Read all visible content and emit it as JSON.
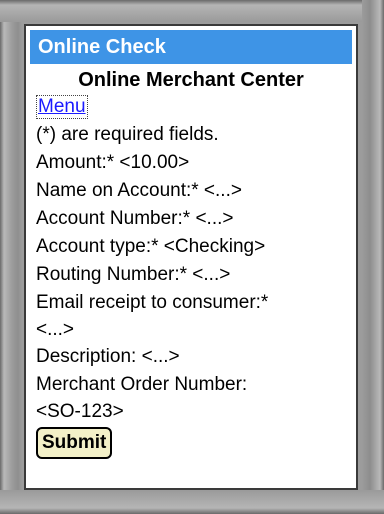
{
  "title_bar": "Online Check",
  "heading": "Online Merchant Center",
  "menu_link": "Menu",
  "required_note": "(*) are required fields.",
  "fields": {
    "amount": "Amount:* <10.00>",
    "name_on_account": "Name on Account:* <...>",
    "account_number": "Account Number:* <...>",
    "account_type": "Account type:* <Checking>",
    "routing_number": "Routing Number:* <...>",
    "email_receipt_label": "Email receipt to consumer:*",
    "email_receipt_value": "<...>",
    "description": "Description: <...>",
    "merchant_order_label": "Merchant Order Number:",
    "merchant_order_value": "<SO-123>"
  },
  "submit_label": "Submit",
  "colors": {
    "title_bar_bg": "#3e94e6",
    "link": "#1a1aff",
    "button_bg": "#f3f0c8"
  }
}
